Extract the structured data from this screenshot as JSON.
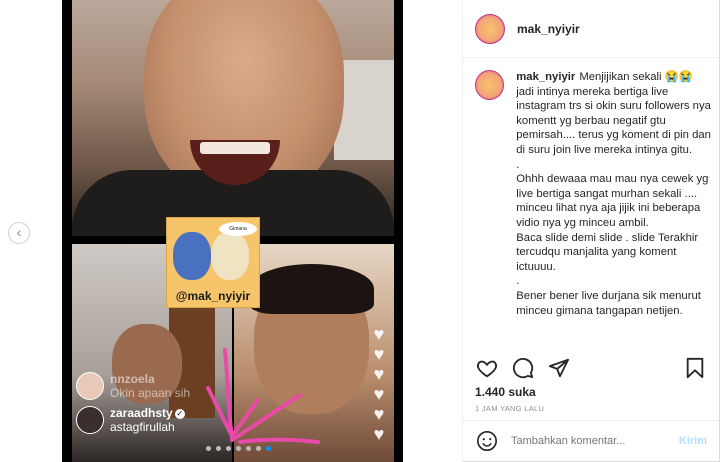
{
  "post": {
    "username": "mak_nyiyir",
    "caption_lines": [
      "Menjijikan sekali 😭😭 jadi intinya mereka bertiga live instagram trs si okin suru followers nya komentt yg berbau negatif gtu pemirsah.... terus yg koment di pin dan di suru join live mereka intinya gitu.",
      ".",
      "Ohhh dewaaa mau mau nya cewek yg live bertiga sangat murhan sekali .... minceu lihat nya aja jijik ini beberapa vidio nya yg minceu ambil.",
      "Baca slide demi slide . slide Terakhir tercudqu manjalita yang koment ictuuuu.",
      ".",
      "Bener bener live durjana sik menurut minceu gimana tangapan netijen."
    ],
    "likes": "1.440 suka",
    "time_ago": "1 JAM YANG LALU",
    "comment_placeholder": "Tambahkan komentar...",
    "post_button": "Kirim"
  },
  "media": {
    "sticker_handle": "@mak_nyiyir",
    "sticker_bubble": "Gimana",
    "live_comments": [
      {
        "user": "nnzoela",
        "text": "Okin apaan sih"
      },
      {
        "user": "zaraadhsty",
        "text": "astagfirullah"
      }
    ],
    "slide_count": 7,
    "active_slide": 6
  },
  "icons": {
    "like": "heart-icon",
    "comment": "comment-icon",
    "share": "share-icon",
    "save": "bookmark-icon",
    "emoji": "emoji-icon",
    "prev": "chevron-left-icon",
    "verified": "verified-icon"
  },
  "colors": {
    "accent": "#0095f6",
    "scribble": "#e84aa8"
  }
}
